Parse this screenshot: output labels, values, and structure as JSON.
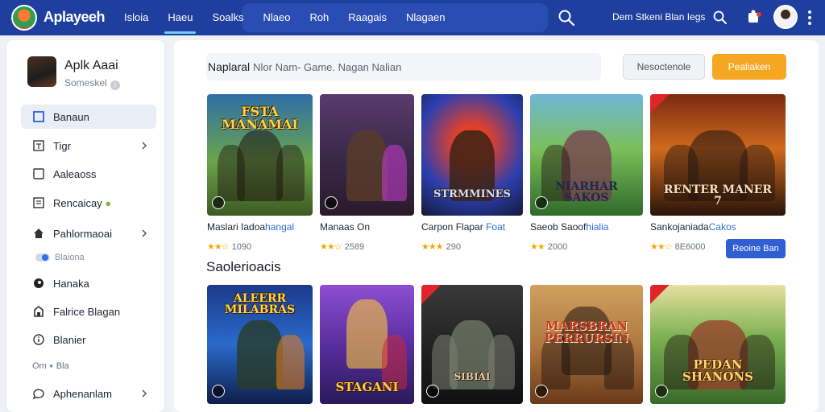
{
  "header": {
    "logo_text": "Aplayeeh",
    "logo_accent": "",
    "nav": [
      "Isloia",
      "Haeu",
      "Soalks",
      "Nlaeo",
      "Roh",
      "Raagais",
      "Nlagaen"
    ],
    "right_text": "Dem Stkeni Blan Iegs",
    "colors": {
      "bar": "#1f3f9e",
      "active_underline": "#6fd0ff"
    }
  },
  "sidebar": {
    "profile_name": "Aplk Aaai",
    "profile_sub": "Someskel",
    "items": [
      {
        "label": "Banaun",
        "icon": "square-icon",
        "chevron": false
      },
      {
        "label": "Tigr",
        "icon": "edit-box-icon",
        "chevron": true
      },
      {
        "label": "Aaleaoss",
        "icon": "square-icon",
        "chevron": false
      },
      {
        "label": "Rencaicay",
        "icon": "document-icon",
        "badge": "●",
        "chevron": false
      },
      {
        "label": "Pahlormaoai",
        "icon": "home-icon",
        "chevron": true
      },
      {
        "label": "Blaiona",
        "icon": "toggle-icon",
        "small": true
      },
      {
        "label": "Hanaka",
        "icon": "circle-icon",
        "chevron": false
      },
      {
        "label": "Falrice Blagan",
        "icon": "house-icon",
        "chevron": false
      },
      {
        "label": "Blanier",
        "icon": "info-icon",
        "chevron": false
      },
      {
        "label": "Om ⭑ Bla",
        "small": true
      },
      {
        "label": "Aphenanlam",
        "icon": "chat-icon",
        "chevron": true
      }
    ]
  },
  "main": {
    "search": {
      "strong": "Naplaral",
      "placeholder": "Nlor Nam- Game. Nagan Nalian"
    },
    "btn_secondary": "Nesoctenole",
    "btn_primary": "Pealiaken",
    "row1": [
      {
        "art": "FSTA MANAMAI",
        "name": "Maslari Iadoa",
        "name_hl": "hangal",
        "stars": "★★☆",
        "rating": "1090"
      },
      {
        "art": "",
        "name": "Manaas On",
        "name_hl": "",
        "stars": "★★☆",
        "rating": "2589"
      },
      {
        "art": "STRMMINES",
        "name": "Carpon Flapar",
        "name_hl": "Foat",
        "stars": "★★★",
        "rating": "290"
      },
      {
        "art": "NIARHAR SAKOS",
        "name": "Saeob Saoof",
        "name_hl": "hialia",
        "stars": "★★",
        "rating": "2000"
      },
      {
        "art": "RENTER MANER 7",
        "name": "Sankojaniada",
        "name_hl": "Cakos",
        "stars": "★★☆",
        "rating": "8E6000"
      }
    ],
    "btn_small": "Reoine Ban",
    "section_title": "Saolerioacis",
    "row2": [
      {
        "art": "ALEERR MILABRAS"
      },
      {
        "art": "STAGANI"
      },
      {
        "art": "SIBIAI"
      },
      {
        "art": "MARSBRAN PERRURSIN"
      },
      {
        "art": "PEDAN SHANONS"
      }
    ]
  }
}
